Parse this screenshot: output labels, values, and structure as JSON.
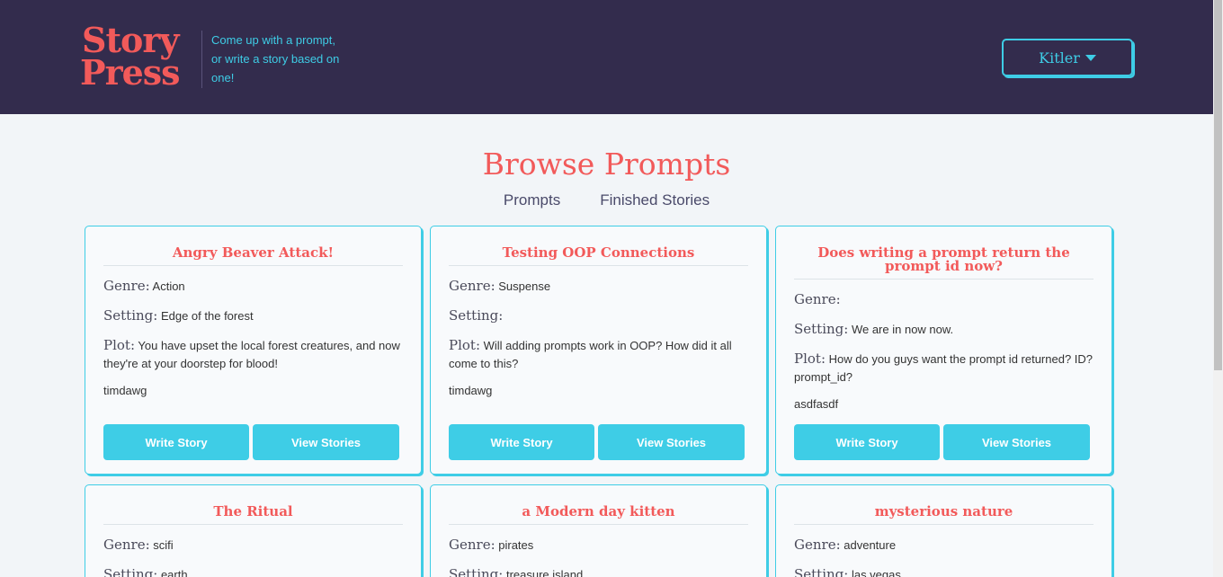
{
  "header": {
    "logo_line1": "Story",
    "logo_line2": "Press",
    "tagline": "Come up with a prompt, or write a story based on one!",
    "user_name": "Kitler"
  },
  "page": {
    "title": "Browse Prompts",
    "tabs": [
      "Prompts",
      "Finished Stories"
    ]
  },
  "labels": {
    "genre": "Genre:",
    "setting": "Setting:",
    "plot": "Plot:",
    "write_story": "Write Story",
    "view_stories": "View Stories"
  },
  "cards": [
    {
      "title": "Angry Beaver Attack!",
      "genre": "Action",
      "setting": "Edge of the forest",
      "plot": "You have upset the local forest creatures, and now they're at your doorstep for blood!",
      "author": "timdawg"
    },
    {
      "title": "Testing OOP Connections",
      "genre": "Suspense",
      "setting": "",
      "plot": "Will adding prompts work in OOP? How did it all come to this?",
      "author": "timdawg"
    },
    {
      "title": "Does writing a prompt return the prompt id now?",
      "genre": "",
      "setting": "We are in now now.",
      "plot": "How do you guys want the prompt id returned? ID? prompt_id?",
      "author": "asdfasdf"
    },
    {
      "title": "The Ritual",
      "genre": "scifi",
      "setting": "earth",
      "plot": "",
      "author": ""
    },
    {
      "title": "a Modern day kitten",
      "genre": "pirates",
      "setting": "treasure island",
      "plot": "",
      "author": ""
    },
    {
      "title": "mysterious nature",
      "genre": "adventure",
      "setting": "las vegas",
      "plot": "",
      "author": ""
    }
  ]
}
